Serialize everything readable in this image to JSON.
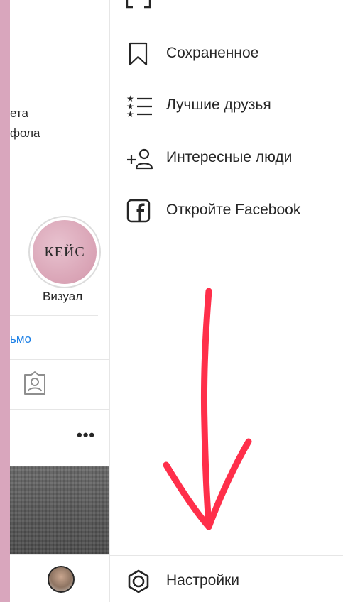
{
  "profile_panel": {
    "bio_line_1": "ета",
    "bio_line_2": "фола",
    "highlight": {
      "cover_text": "КЕЙС",
      "label": "Визуал"
    },
    "email_link": "ьмо",
    "more": "•••"
  },
  "menu": {
    "items": [
      {
        "label": "Сохраненное",
        "icon": "bookmark-icon"
      },
      {
        "label": "Лучшие друзья",
        "icon": "close-friends-list-icon"
      },
      {
        "label": "Интересные люди",
        "icon": "add-person-icon"
      },
      {
        "label": "Откройте Facebook",
        "icon": "facebook-icon"
      }
    ],
    "settings_label": "Настройки",
    "settings_icon": "gear-icon"
  },
  "colors": {
    "background_pink": "#d9a6bd",
    "link_blue": "#1a7fe6",
    "arrow_red": "#ff2f4a"
  }
}
